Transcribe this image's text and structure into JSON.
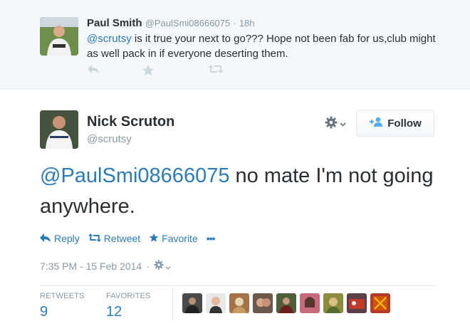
{
  "reply_context": {
    "author_name": "Paul Smith",
    "author_handle": "@PaulSmi08666075",
    "separator": "·",
    "time": "18h",
    "mention": "@scrutsy",
    "text_rest": " is it true your next to go???  Hope not been fab for us,club might as well pack in if everyone deserting them.",
    "actions": [
      "reply-icon",
      "favorite-icon",
      "retweet-icon"
    ]
  },
  "tweet": {
    "author_name": "Nick Scruton",
    "author_handle": "@scrutsy",
    "follow_label": "Follow",
    "mention": "@PaulSmi08666075",
    "text_rest": " no mate I'm not going anywhere.",
    "actions": {
      "reply": "Reply",
      "retweet": "Retweet",
      "favorite": "Favorite",
      "more": "•••"
    },
    "timestamp": "7:35 PM - 15 Feb 2014",
    "timestamp_sep": "·"
  },
  "stats": {
    "retweets_label": "RETWEETS",
    "retweets_count": "9",
    "favorites_label": "FAVORITES",
    "favorites_count": "12"
  },
  "colors": {
    "link": "#2b7bb9",
    "muted": "#8899a6",
    "text": "#292f33",
    "context_bg": "#f5f8fa"
  },
  "favoriter_avatars": 9
}
